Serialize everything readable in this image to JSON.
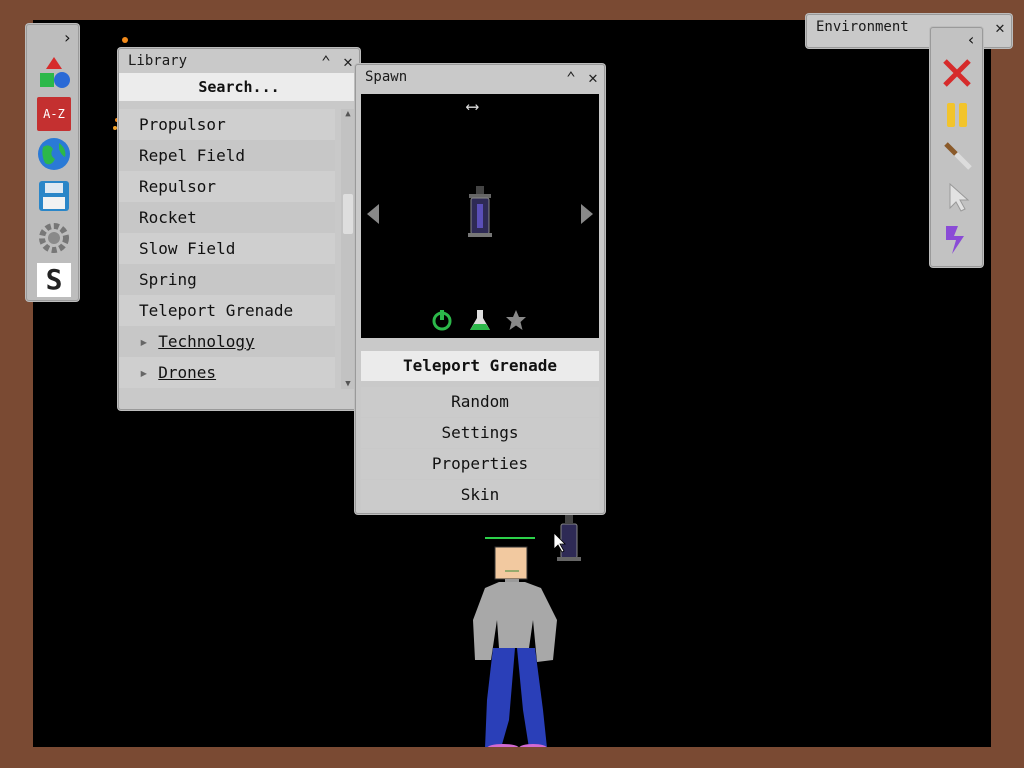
{
  "library": {
    "title": "Library",
    "search_placeholder": "Search...",
    "items": [
      {
        "label": "Propulsor",
        "type": "item"
      },
      {
        "label": "Repel Field",
        "type": "item"
      },
      {
        "label": "Repulsor",
        "type": "item"
      },
      {
        "label": "Rocket",
        "type": "item"
      },
      {
        "label": "Slow Field",
        "type": "item"
      },
      {
        "label": "Spring",
        "type": "item"
      },
      {
        "label": "Teleport Grenade",
        "type": "item"
      },
      {
        "label": "Technology",
        "type": "folder"
      },
      {
        "label": "Drones",
        "type": "folder"
      }
    ]
  },
  "spawn": {
    "title": "Spawn",
    "selected_item": "Teleport Grenade",
    "buttons": [
      "Random",
      "Settings",
      "Properties",
      "Skin"
    ]
  },
  "environment": {
    "title": "Environment"
  },
  "left_toolbar": {
    "icons": [
      "expand-arrow-icon",
      "shapes-icon",
      "a-z-book-icon",
      "globe-icon",
      "save-disk-icon",
      "settings-gear-icon",
      "s-logo-icon"
    ],
    "book_label": "A-Z",
    "logo_letter": "S"
  },
  "right_toolbar": {
    "icons": [
      "delete-x-icon",
      "pause-icon",
      "knife-icon",
      "cursor-icon",
      "lightning-icon"
    ]
  },
  "colors": {
    "frame": "#7a4a33",
    "sandbox": "#000000",
    "panel": "#c9c9c9",
    "delete": "#d62b2b",
    "pause": "#f2c42c",
    "lightning": "#8a4bd6"
  }
}
